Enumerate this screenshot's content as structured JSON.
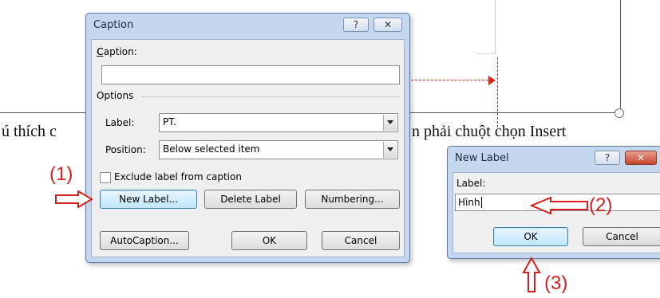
{
  "document": {
    "body_text_left": "ú thích c",
    "body_text_right": "n phải chuột chọn Insert"
  },
  "caption_dialog": {
    "title": "Caption",
    "help_btn": "?",
    "close_btn": "✕",
    "caption_label": "Caption:",
    "caption_value": "",
    "options_label": "Options",
    "label_label": "Label:",
    "label_value": "PT.",
    "position_label": "Position:",
    "position_value": "Below selected item",
    "exclude_label": "Exclude label from caption",
    "new_label_btn": "New Label...",
    "delete_label_btn": "Delete Label",
    "numbering_btn": "Numbering...",
    "autocaption_btn": "AutoCaption...",
    "ok_btn": "OK",
    "cancel_btn": "Cancel"
  },
  "new_label_dialog": {
    "title": "New Label",
    "help_btn": "?",
    "close_btn": "✕",
    "label_label": "Label:",
    "label_value": "Hình",
    "ok_btn": "OK",
    "cancel_btn": "Cancel"
  },
  "annotations": {
    "step1": "(1)",
    "step2": "(2)",
    "step3": "(3)",
    "color": "#d91e1e"
  }
}
